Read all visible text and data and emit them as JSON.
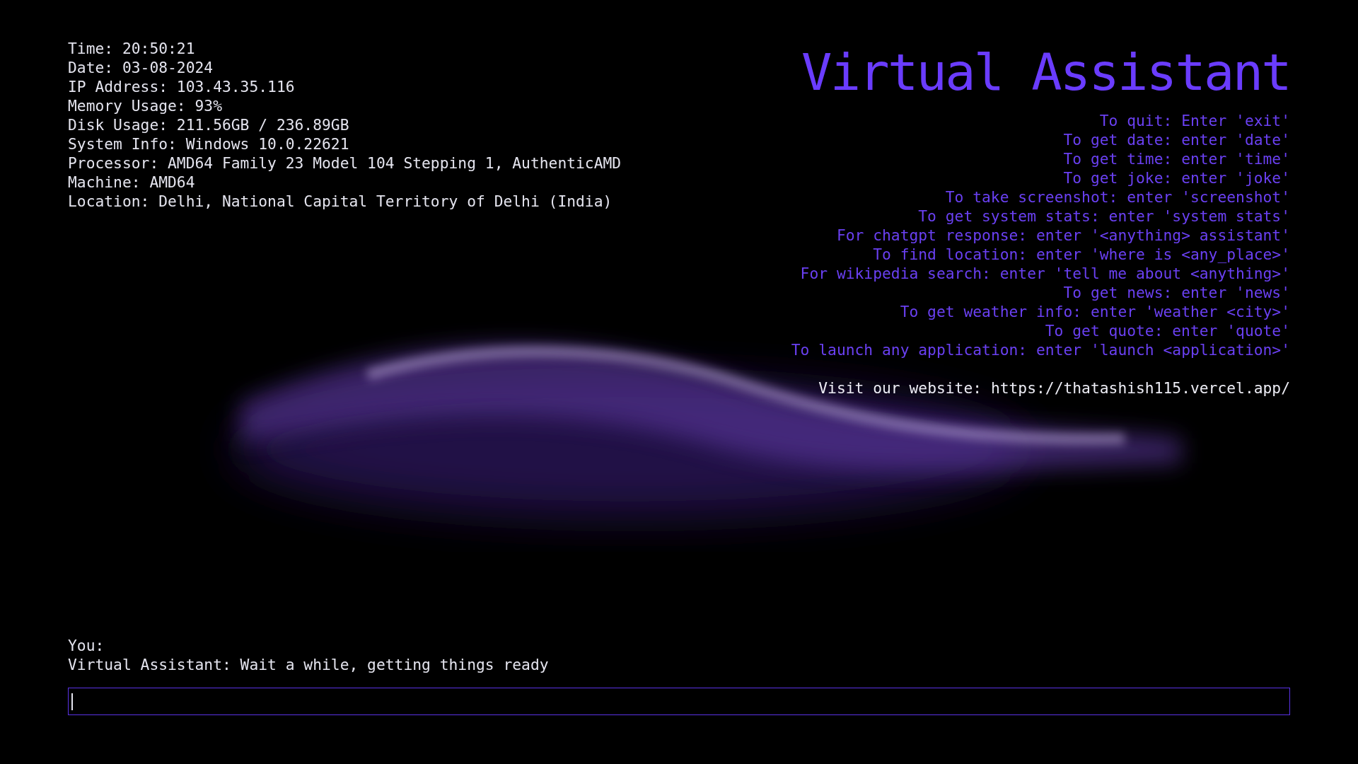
{
  "system_info": [
    "Time: 20:50:21",
    "Date: 03-08-2024",
    "IP Address: 103.43.35.116",
    "Memory Usage: 93%",
    "Disk Usage: 211.56GB / 236.89GB",
    "System Info: Windows 10.0.22621",
    "Processor: AMD64 Family 23 Model 104 Stepping 1, AuthenticAMD",
    "Machine: AMD64",
    "Location: Delhi, National Capital Territory of Delhi (India)"
  ],
  "title": "Virtual Assistant",
  "commands": [
    "To quit: Enter 'exit'",
    "To get date: enter 'date'",
    "To get time: enter 'time'",
    "To get joke: enter 'joke'",
    "To take screenshot: enter 'screenshot'",
    "To get system stats: enter 'system stats'",
    "For chatgpt response: enter '<anything> assistant'",
    "To find location: enter 'where is <any_place>'",
    "For wikipedia search: enter 'tell me about <anything>'",
    "To get news: enter 'news'",
    "To get weather info: enter 'weather <city>'",
    "To get quote: enter 'quote'",
    "To launch any application: enter 'launch <application>'"
  ],
  "website": "Visit our website: https://thatashish115.vercel.app/",
  "conversation": [
    "You:",
    "Virtual Assistant: Wait a while, getting things ready"
  ],
  "input": {
    "focused": true
  }
}
